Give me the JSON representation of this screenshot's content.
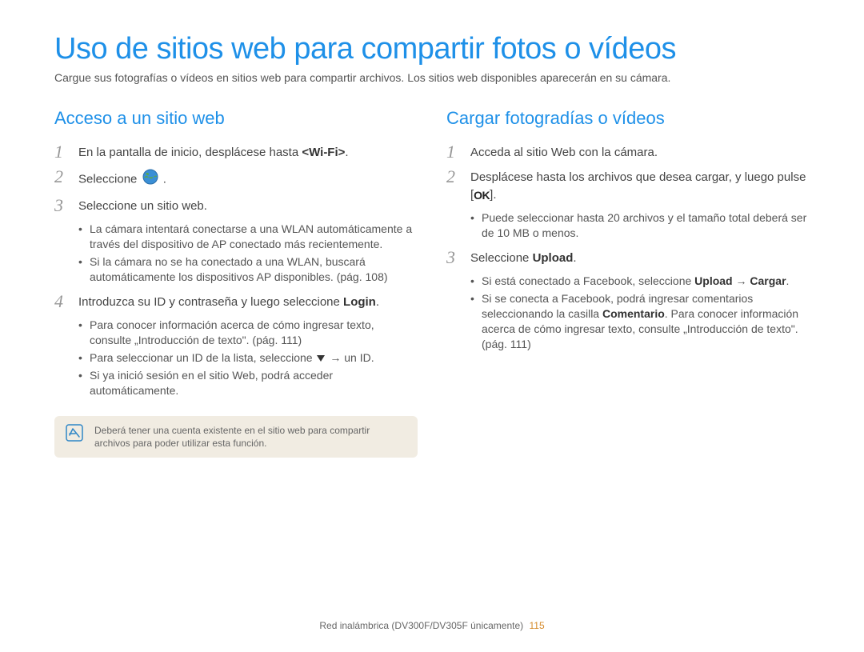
{
  "title": "Uso de sitios web para compartir fotos o vídeos",
  "subtitle": "Cargue sus fotografías o vídeos en sitios web para compartir archivos. Los sitios web disponibles aparecerán en su cámara.",
  "left": {
    "heading": "Acceso a un sitio web",
    "steps": {
      "1": {
        "num": "1",
        "text_a": "En la pantalla de inicio, desplácese hasta ",
        "bold": "<Wi-Fi>",
        "text_b": "."
      },
      "2": {
        "num": "2",
        "text_a": "Seleccione ",
        "text_b": "."
      },
      "3": {
        "num": "3",
        "text": "Seleccione un sitio web.",
        "bullets": {
          "a": "La cámara intentará conectarse a una WLAN automáticamente a través del dispositivo de AP conectado más recientemente.",
          "b": "Si la cámara no se ha conectado a una WLAN, buscará automáticamente los dispositivos AP disponibles. (pág. 108)"
        }
      },
      "4": {
        "num": "4",
        "text_a": "Introduzca su ID y contraseña y luego seleccione ",
        "bold": "Login",
        "text_b": ".",
        "bullets": {
          "a": "Para conocer información acerca de cómo ingresar texto, consulte „Introducción de texto\". (pág. 111)",
          "b_pre": "Para seleccionar un ID de la lista, seleccione ",
          "b_post": " → un ID.",
          "c": "Si ya inició sesión en el sitio Web, podrá acceder automáticamente."
        }
      }
    },
    "note": "Deberá tener una cuenta existente en el sitio web para compartir archivos para poder utilizar esta función."
  },
  "right": {
    "heading": "Cargar fotogradías o vídeos",
    "steps": {
      "1": {
        "num": "1",
        "text": "Acceda al sitio Web con la cámara."
      },
      "2": {
        "num": "2",
        "text_a": "Desplácese hasta los archivos que desea cargar, y luego pulse [",
        "ok": "OK",
        "text_b": "].",
        "bullets": {
          "a": "Puede seleccionar hasta 20 archivos y el tamaño total deberá ser de 10 MB o menos."
        }
      },
      "3": {
        "num": "3",
        "text_a": "Seleccione ",
        "bold": "Upload",
        "text_b": ".",
        "bullets": {
          "a_pre": "Si está conectado a Facebook, seleccione ",
          "a_b1": "Upload",
          "a_arrow": " → ",
          "a_b2": "Cargar",
          "a_post": ".",
          "b_pre": "Si se conecta a Facebook, podrá ingresar comentarios seleccionando la casilla ",
          "b_bold": "Comentario",
          "b_post": ". Para conocer información acerca de cómo ingresar texto, consulte „Introducción de texto\". (pág. 111)"
        }
      }
    }
  },
  "footer": {
    "text": "Red inalámbrica (DV300F/DV305F únicamente)",
    "page": "115"
  }
}
